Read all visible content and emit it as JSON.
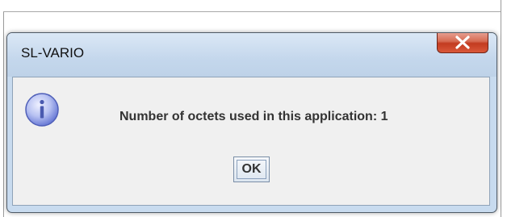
{
  "window": {
    "title": "SL-VARIO",
    "close_icon": "close-icon"
  },
  "message": {
    "icon": "info-icon",
    "text": "Number of octets used in this application: 1"
  },
  "buttons": {
    "ok_label": "OK"
  },
  "colors": {
    "close_button": "#c7472d",
    "title_bar": "#c8dbef",
    "content_background": "#f0f0f0",
    "info_icon": "#6a7bd6"
  }
}
